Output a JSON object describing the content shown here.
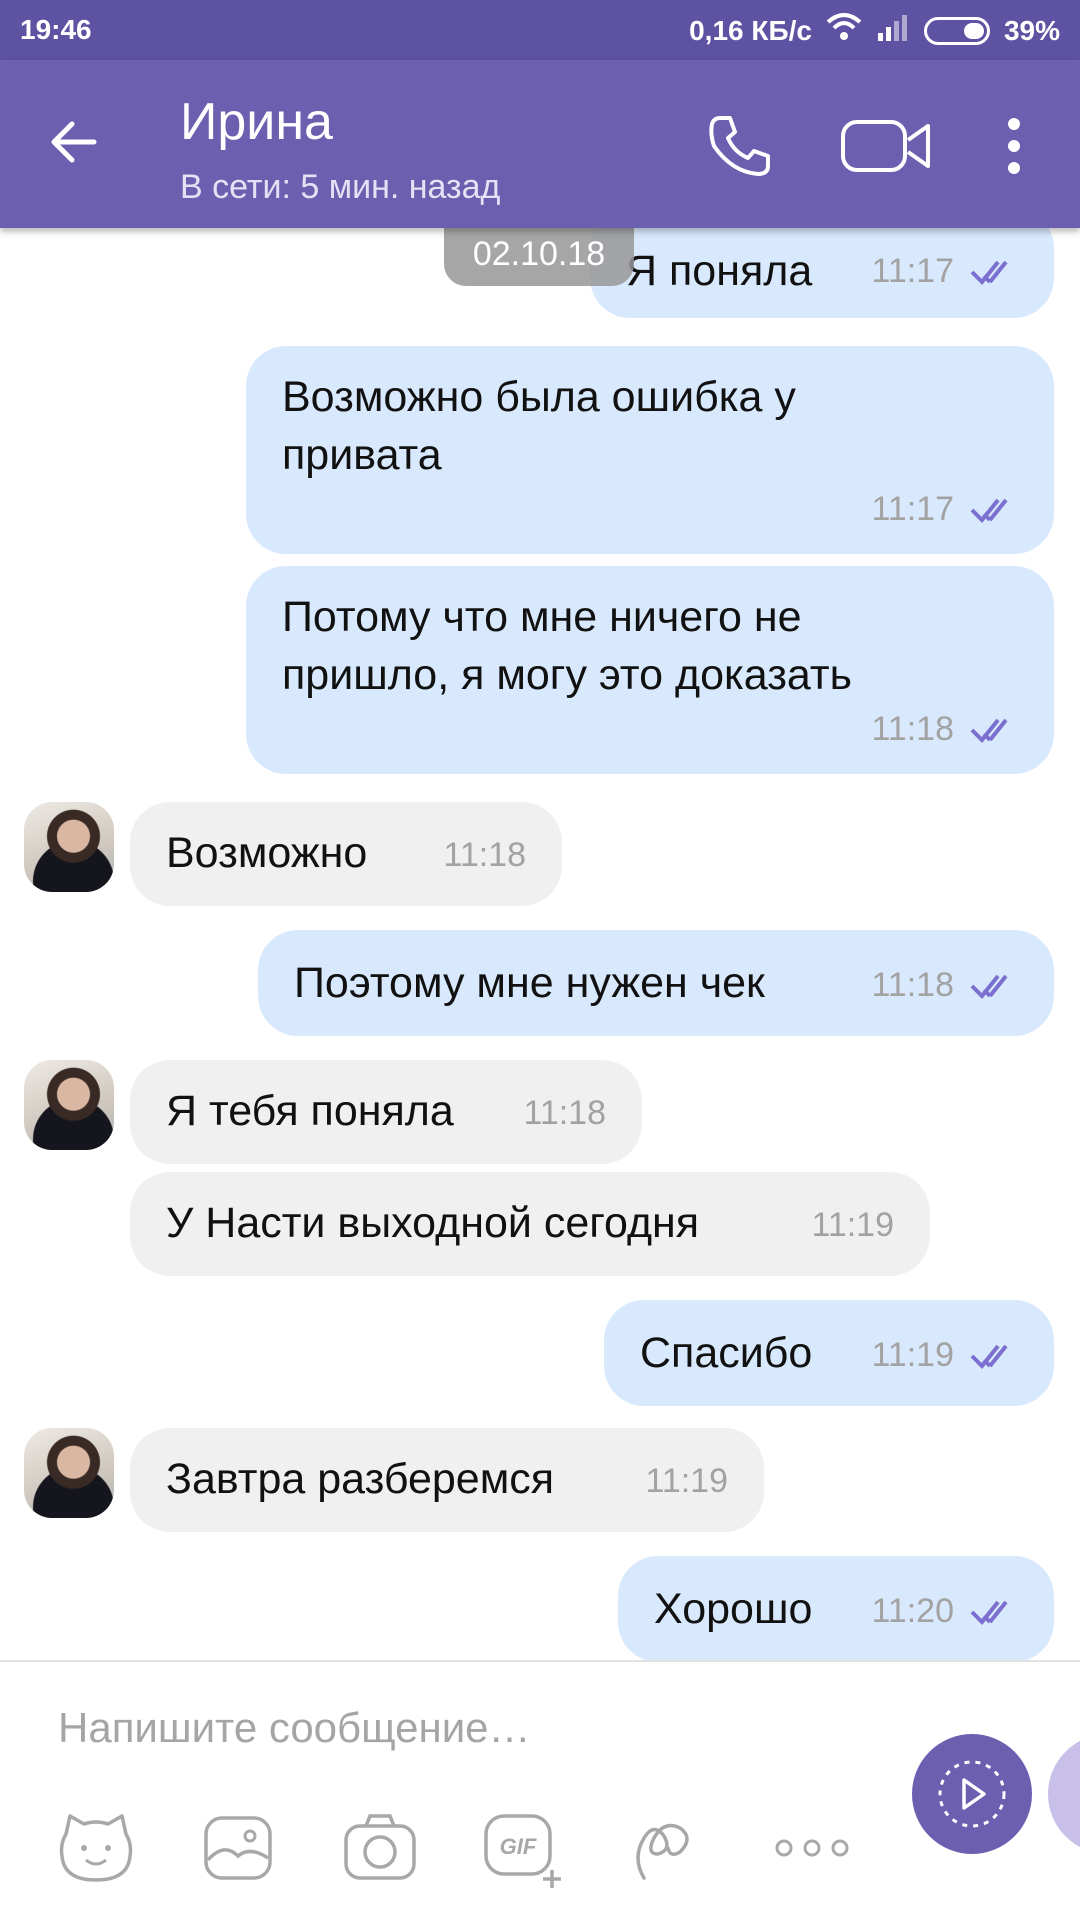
{
  "status_bar": {
    "time": "19:46",
    "net_speed": "0,16 КБ/с",
    "battery": "39%"
  },
  "header": {
    "contact_name": "Ирина",
    "contact_status": "В сети: 5 мин. назад",
    "back_icon": "arrow-left-icon",
    "call_icon": "phone-icon",
    "video_icon": "video-camera-icon",
    "more_icon": "more-vert-icon",
    "color": "#6c5fb0"
  },
  "date_separator": "02.10.18",
  "messages": [
    {
      "dir": "out",
      "text": "Я поняла",
      "time": "11:17",
      "read": true
    },
    {
      "dir": "out",
      "text": "Возможно была ошибка у\nпривата",
      "time": "11:17",
      "read": true
    },
    {
      "dir": "out",
      "text": "Потому что мне ничего не\nпришло, я могу это доказать",
      "time": "11:18",
      "read": true
    },
    {
      "dir": "in",
      "text": "Возможно",
      "time": "11:18",
      "avatar": true
    },
    {
      "dir": "out",
      "text": "Поэтому мне нужен чек",
      "time": "11:18",
      "read": true
    },
    {
      "dir": "in",
      "text": "Я тебя поняла",
      "time": "11:18",
      "avatar": true
    },
    {
      "dir": "in",
      "text": "У Насти выходной сегодня",
      "time": "11:19",
      "avatar": false
    },
    {
      "dir": "out",
      "text": "Спасибо",
      "time": "11:19",
      "read": true
    },
    {
      "dir": "in",
      "text": "Завтра разберемся",
      "time": "11:19",
      "avatar": true
    },
    {
      "dir": "out",
      "text": "Хорошо",
      "time": "11:20",
      "read": true
    }
  ],
  "composer": {
    "placeholder": "Напишите сообщение…",
    "tools": [
      "sticker-icon",
      "gallery-icon",
      "camera-icon",
      "gif-icon",
      "doodle-icon",
      "more-horiz-icon"
    ],
    "gif_label": "GIF",
    "send_icon": "send-play-icon"
  },
  "colors": {
    "outgoing_bubble": "#d9e9fd",
    "incoming_bubble": "#f0f0f0",
    "read_ticks": "#7b6fd0"
  }
}
